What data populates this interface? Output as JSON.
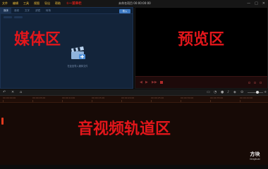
{
  "menubar": {
    "items": [
      "文件",
      "编辑",
      "工具",
      "视图",
      "导出",
      "帮助"
    ],
    "annotation": "①一菜单栏",
    "title": "未命名项目 00:00:00:00",
    "controls": [
      "—",
      "□",
      "✕"
    ]
  },
  "media": {
    "tabs": [
      "媒体",
      "音频",
      "文字",
      "滤镜",
      "转场"
    ],
    "import_label": "导入",
    "drop_text": "在此处导入媒体文件",
    "annotation": "媒体区"
  },
  "preview": {
    "annotation": "预览区",
    "controls": [
      "◀",
      "▶",
      "▶▶"
    ]
  },
  "timeline": {
    "annotation": "音视频轨道区",
    "ruler_labels": [
      "00:00:00:00",
      "00:00:05:00",
      "00:00:10:00",
      "00:00:15:00",
      "00:00:20:00",
      "00:00:25:00",
      "00:00:30:00",
      "00:00:35:00",
      "00:00:40:00"
    ]
  },
  "watermark": {
    "line1": "方块",
    "line2": "fangkuai"
  },
  "colors": {
    "annotation_red": "#e3161b",
    "menu_yellow": "#f3c33a",
    "media_blue": "#13243a",
    "accent_blue": "#3c79c3"
  }
}
